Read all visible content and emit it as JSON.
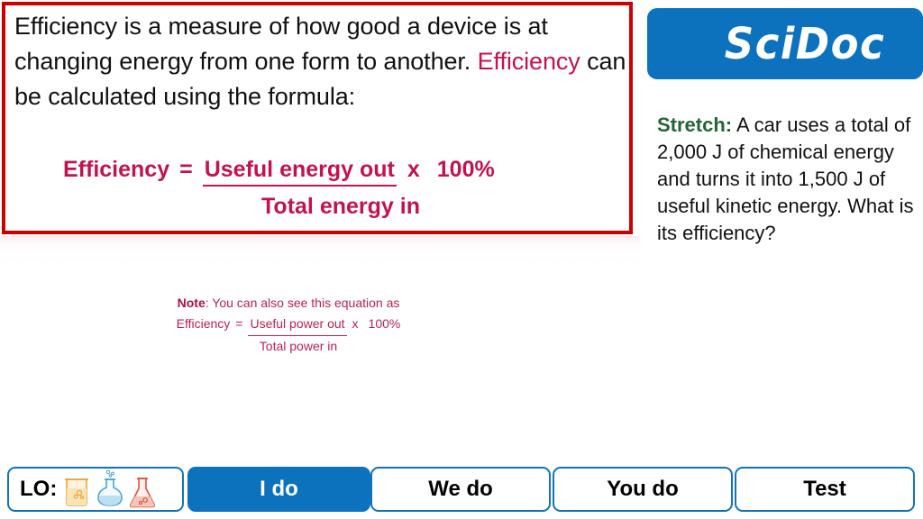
{
  "definition": {
    "line1": "Efficiency is a measure of how good a device is at",
    "line2": "changing energy from one form to another.",
    "line3_highlight": "Efficiency",
    "line3_rest": " can be calculated using the formula:"
  },
  "formula": {
    "subject": "Efficiency",
    "equals": "=",
    "numerator": "Useful energy out",
    "denominator": "Total energy in",
    "times": "x",
    "percent": "100%"
  },
  "note": {
    "label": "Note",
    "intro": ": You can also see this equation as",
    "subject": "Efficiency",
    "equals": "=",
    "numerator": "Useful power out",
    "denominator": "Total power in",
    "times": "x",
    "percent": "100%"
  },
  "logo": {
    "text": "SciDoc"
  },
  "stretch": {
    "label": "Stretch:",
    "question": " A car uses a total of 2,000 J of chemical energy and turns it into 1,500 J of useful kinetic energy. What is its efficiency?"
  },
  "nav": {
    "lo_label": "LO:",
    "buttons": [
      {
        "label": "I do",
        "active": true
      },
      {
        "label": "We do",
        "active": false
      },
      {
        "label": "You do",
        "active": false
      },
      {
        "label": "Test",
        "active": false
      }
    ]
  },
  "colors": {
    "crimson": "#C3134E",
    "red_border": "#CC0000",
    "brand_blue": "#0C72BE",
    "stretch_green": "#256436",
    "beaker_amber": "#E8A33D",
    "flask_blue": "#4FA3D9",
    "flask_red": "#D9533B"
  }
}
